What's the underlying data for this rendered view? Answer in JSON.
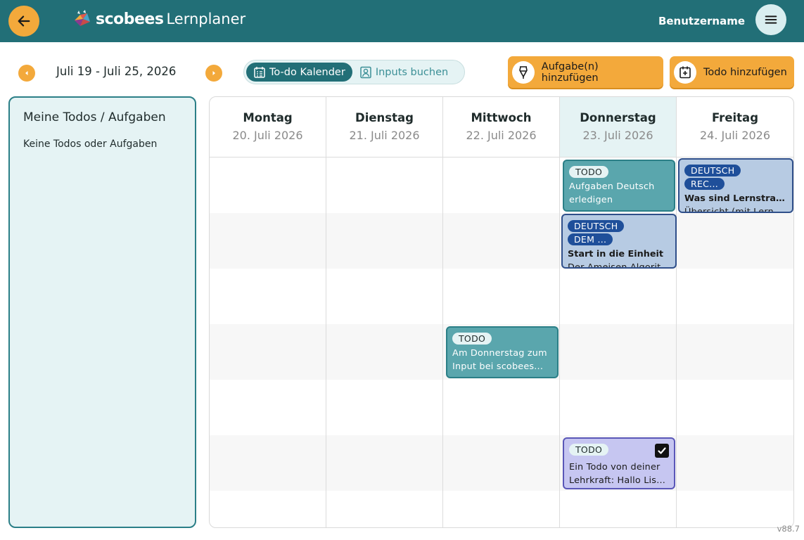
{
  "header": {
    "brand": "scobees",
    "product": "Lernplaner",
    "username": "Benutzername",
    "back_icon": "arrow-left-icon",
    "menu_icon": "hamburger-menu-icon"
  },
  "toolbar": {
    "date_range": "Juli 19 - Juli 25, 2026",
    "view_toggle": {
      "active": "To-do Kalender",
      "inactive": "Inputs buchen"
    },
    "add_task_label": "Aufgabe(n) hinzufügen",
    "add_todo_label": "Todo hinzufügen"
  },
  "sidebar": {
    "title": "Meine Todos / Aufgaben",
    "empty_text": "Keine Todos oder Aufgaben"
  },
  "calendar": {
    "days": [
      {
        "name": "Montag",
        "date": "20. Juli 2026"
      },
      {
        "name": "Dienstag",
        "date": "21. Juli 2026"
      },
      {
        "name": "Mittwoch",
        "date": "22. Juli 2026"
      },
      {
        "name": "Donnerstag",
        "date": "23. Juli 2026"
      },
      {
        "name": "Freitag",
        "date": "24. Juli 2026"
      }
    ],
    "today_index": 3,
    "events": {
      "thu_todo": {
        "tag": "TODO",
        "line1": "Aufgaben Deutsch",
        "line2": "erledigen"
      },
      "thu_input": {
        "tag1": "DEUTSCH",
        "tag2": "DEM ...",
        "title": "Start in die Einheit",
        "desc": "Der Ameisen Algorith..."
      },
      "fri_input": {
        "tag1": "DEUTSCH",
        "tag2": "REC...",
        "title": "Was sind Lernstrate...",
        "desc": "Übersicht (mit Lernk..."
      },
      "wed_todo": {
        "tag": "TODO",
        "line1": "Am Donnerstag zum",
        "line2": "Input bei scobees..."
      },
      "thu_teacher": {
        "tag": "TODO",
        "line1": "Ein Todo von deiner",
        "line2": "Lehrkraft: Hallo Lisa,...",
        "checked": true
      }
    }
  },
  "version": "v88.7",
  "colors": {
    "header_teal": "#226f77",
    "accent_orange": "#f3a93b",
    "light_teal": "#e5f3f4",
    "todo_card": "#5aa6ad",
    "input_card": "#b7cbe3",
    "teacher_card": "#c6c6f1"
  }
}
